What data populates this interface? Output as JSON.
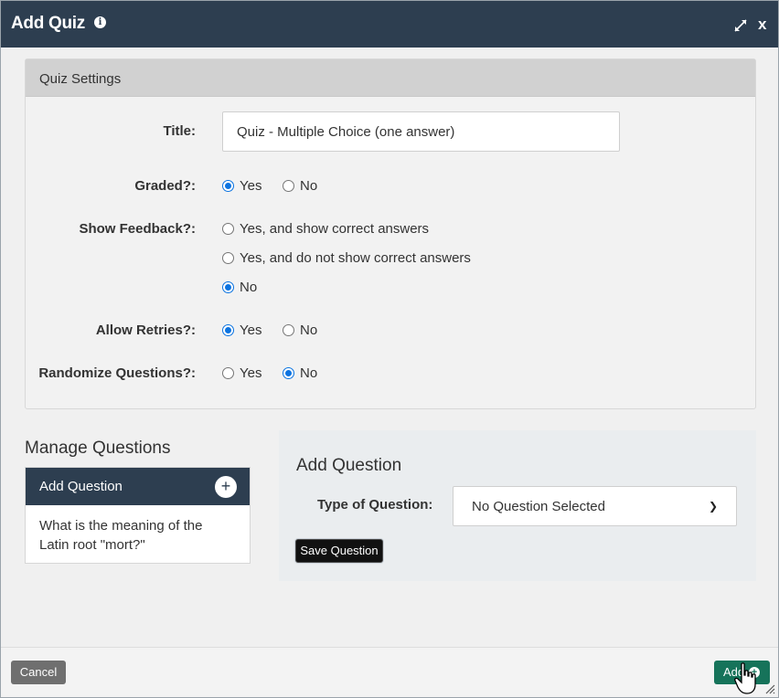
{
  "dialog": {
    "title": "Add Quiz",
    "info_icon": "info-icon",
    "expand_icon": "expand-arrows-icon",
    "close_label": "x"
  },
  "settings": {
    "header": "Quiz Settings",
    "title_label": "Title:",
    "title_value": "Quiz - Multiple Choice (one answer)",
    "graded": {
      "label": "Graded?:",
      "options": [
        "Yes",
        "No"
      ],
      "selected": "Yes"
    },
    "show_feedback": {
      "label": "Show Feedback?:",
      "options": [
        "Yes, and show correct answers",
        "Yes, and do not show correct answers",
        "No"
      ],
      "selected": "No"
    },
    "allow_retries": {
      "label": "Allow Retries?:",
      "options": [
        "Yes",
        "No"
      ],
      "selected": "Yes"
    },
    "randomize": {
      "label": "Randomize Questions?:",
      "options": [
        "Yes",
        "No"
      ],
      "selected": "No"
    }
  },
  "manage": {
    "title": "Manage Questions",
    "list_header": "Add Question",
    "add_icon": "plus-icon",
    "questions": [
      "What is the meaning of the Latin root \"mort?\""
    ]
  },
  "add_question": {
    "title": "Add Question",
    "type_label": "Type of Question:",
    "type_selected": "No Question Selected",
    "save_label": "Save Question"
  },
  "footer": {
    "cancel_label": "Cancel",
    "add_label": "Add",
    "colors": {
      "primary": "#16735a",
      "header": "#2d3e50",
      "radio": "#0b73e0"
    }
  }
}
